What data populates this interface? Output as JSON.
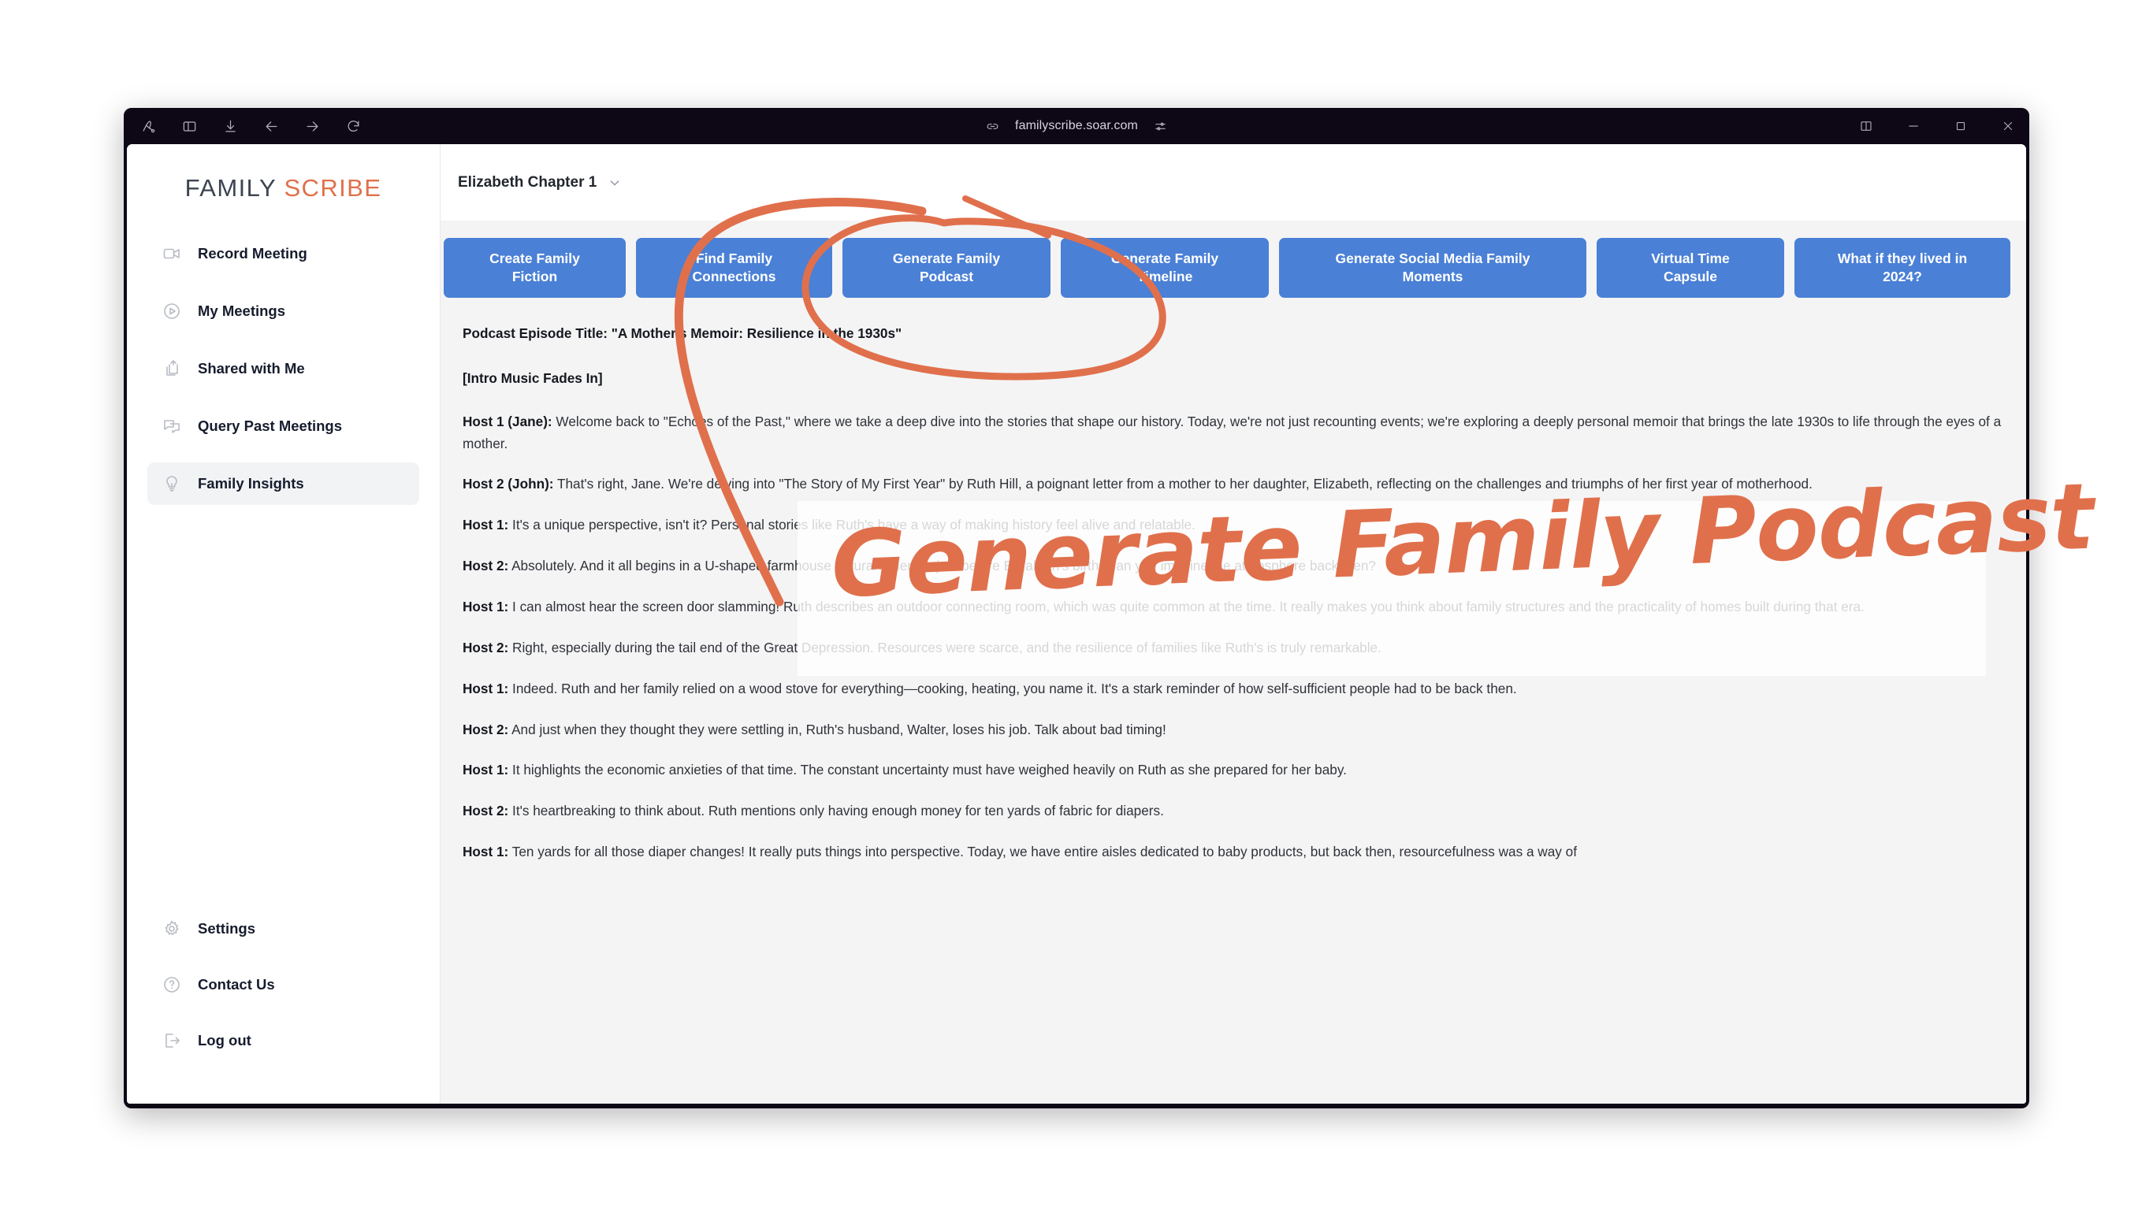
{
  "browser": {
    "url": "familyscribe.soar.com",
    "left_icons": [
      {
        "name": "arc-logo-icon"
      },
      {
        "name": "sidebar-toggle-icon"
      },
      {
        "name": "download-icon"
      },
      {
        "name": "back-arrow-icon"
      },
      {
        "name": "forward-arrow-icon"
      },
      {
        "name": "reload-icon"
      }
    ],
    "address_icons": [
      {
        "name": "link-icon"
      },
      {
        "name": "page-settings-sliders-icon"
      }
    ],
    "window_controls": [
      {
        "name": "split-view-icon"
      },
      {
        "name": "minimize-icon"
      },
      {
        "name": "maximize-icon"
      },
      {
        "name": "close-icon"
      }
    ]
  },
  "sidebar": {
    "logo": {
      "first": "FAMILY",
      "second": "SCRIBE"
    },
    "items": [
      {
        "label": "Record Meeting",
        "icon": "video-camera-icon",
        "active": false
      },
      {
        "label": "My Meetings",
        "icon": "play-circle-icon",
        "active": false
      },
      {
        "label": "Shared with Me",
        "icon": "share-icon",
        "active": false
      },
      {
        "label": "Query Past Meetings",
        "icon": "chat-bubbles-icon",
        "active": false
      },
      {
        "label": "Family Insights",
        "icon": "lightbulb-icon",
        "active": true
      }
    ],
    "bottom_items": [
      {
        "label": "Settings",
        "icon": "gear-icon"
      },
      {
        "label": "Contact Us",
        "icon": "question-circle-icon"
      },
      {
        "label": "Log out",
        "icon": "logout-arrow-icon"
      }
    ]
  },
  "header": {
    "chapter": "Elizabeth Chapter 1",
    "caret_icon": "chevron-down-icon"
  },
  "actions": {
    "buttons": [
      {
        "label": "Create Family\nFiction"
      },
      {
        "label": "Find Family\nConnections"
      },
      {
        "label": "Generate Family\nPodcast"
      },
      {
        "label": "Generate Family\nTimeline"
      },
      {
        "label": "Generate Social Media Family\nMoments"
      },
      {
        "label": "Virtual Time\nCapsule"
      },
      {
        "label": "What if they lived in\n2024?"
      }
    ]
  },
  "transcript": {
    "title": "Podcast Episode Title: \"A Mother's Memoir: Resilience in the 1930s\"",
    "cue": "[Intro Music Fades In]",
    "lines": [
      {
        "speaker": "Host 1 (Jane):",
        "text": " Welcome back to \"Echoes of the Past,\" where we take a deep dive into the stories that shape our history. Today, we're not just recounting events; we're exploring a deeply personal memoir that brings the late 1930s to life through the eyes of a mother."
      },
      {
        "speaker": "Host 2 (John):",
        "text": " That's right, Jane. We're delving into \"The Story of My First Year\" by Ruth Hill, a poignant letter from a mother to her daughter, Elizabeth, reflecting on the challenges and triumphs of her first year of motherhood."
      },
      {
        "speaker": "Host 1:",
        "text": " It's a unique perspective, isn't it? Personal stories like Ruth's have a way of making history feel alive and relatable."
      },
      {
        "speaker": "Host 2:",
        "text": " Absolutely. And it all begins in a U-shaped farmhouse in rural America, just before Elizabeth's birth. Can you imagine the atmosphere back then?"
      },
      {
        "speaker": "Host 1:",
        "text": " I can almost hear the screen door slamming! Ruth describes an outdoor connecting room, which was quite common at the time. It really makes you think about family structures and the practicality of homes built during that era."
      },
      {
        "speaker": "Host 2:",
        "text": " Right, especially during the tail end of the Great Depression. Resources were scarce, and the resilience of families like Ruth's is truly remarkable."
      },
      {
        "speaker": "Host 1:",
        "text": " Indeed. Ruth and her family relied on a wood stove for everything—cooking, heating, you name it. It's a stark reminder of how self-sufficient people had to be back then."
      },
      {
        "speaker": "Host 2:",
        "text": " And just when they thought they were settling in, Ruth's husband, Walter, loses his job. Talk about bad timing!"
      },
      {
        "speaker": "Host 1:",
        "text": " It highlights the economic anxieties of that time. The constant uncertainty must have weighed heavily on Ruth as she prepared for her baby."
      },
      {
        "speaker": "Host 2:",
        "text": " It's heartbreaking to think about. Ruth mentions only having enough money for ten yards of fabric for diapers."
      },
      {
        "speaker": "Host 1:",
        "text": " Ten yards for all those diaper changes! It really puts things into perspective. Today, we have entire aisles dedicated to baby products, but back then, resourcefulness was a way of"
      }
    ]
  },
  "annotation": {
    "text": "Generate Family Podcast",
    "color": "#e0704c",
    "target_button": "Generate Family Podcast"
  }
}
